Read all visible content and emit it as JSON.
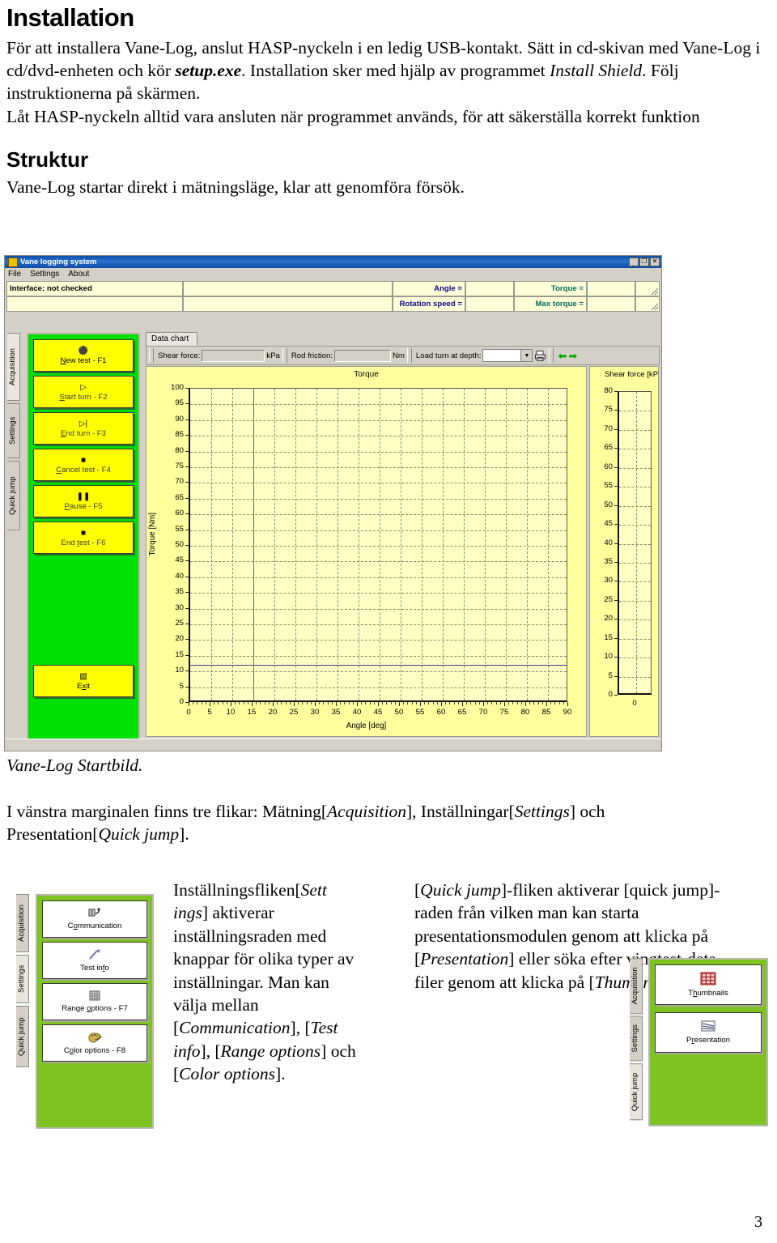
{
  "page": {
    "number": "3"
  },
  "sections": [
    {
      "heading": "Installation",
      "paragraph_runs": [
        {
          "t": "För att installera Vane-Log, anslut HASP-nyckeln i en ledig USB-kontakt. Sätt in cd-skivan med Vane-Log i cd/dvd-enheten och kör ",
          "s": "n"
        },
        {
          "t": "setup.exe",
          "s": "bi"
        },
        {
          "t": ". Installation sker med hjälp av programmet ",
          "s": "n"
        },
        {
          "t": "Install Shield",
          "s": "i"
        },
        {
          "t": ". Följ instruktionerna på skärmen.",
          "s": "n"
        },
        {
          "t": "BR",
          "s": "br"
        },
        {
          "t": "Låt HASP-nyckeln alltid vara ansluten när programmet används, för att säkerställa korrekt funktion",
          "s": "n"
        }
      ]
    },
    {
      "heading": "Struktur",
      "paragraph_runs": [
        {
          "t": "Vane-Log startar direkt i mätningsläge, klar att genomföra försök.",
          "s": "n"
        }
      ]
    }
  ],
  "caption": "Vane-Log Startbild.",
  "tabs_sentence_runs": [
    {
      "t": "I vänstra marginalen finns tre flikar: Mätning[",
      "s": "n"
    },
    {
      "t": "Acquisition",
      "s": "i"
    },
    {
      "t": "], Inställningar[",
      "s": "n"
    },
    {
      "t": "Settings",
      "s": "i"
    },
    {
      "t": "] och Presentation[",
      "s": "n"
    },
    {
      "t": "Quick jump",
      "s": "i"
    },
    {
      "t": "].",
      "s": "n"
    }
  ],
  "col_left_runs": [
    {
      "t": "Inställningsfliken[",
      "s": "n"
    },
    {
      "t": "Sett ings",
      "s": "i"
    },
    {
      "t": "] aktiverar inställningsraden med knappar för olika typer av inställningar. Man kan välja mellan [",
      "s": "n"
    },
    {
      "t": "Communication",
      "s": "i"
    },
    {
      "t": "], [",
      "s": "n"
    },
    {
      "t": "Test info",
      "s": "i"
    },
    {
      "t": "], [",
      "s": "n"
    },
    {
      "t": "Range options",
      "s": "i"
    },
    {
      "t": "] och [",
      "s": "n"
    },
    {
      "t": "Color options",
      "s": "i"
    },
    {
      "t": "].",
      "s": "n"
    }
  ],
  "col_right_runs": [
    {
      "t": "[",
      "s": "n"
    },
    {
      "t": "Quick jump",
      "s": "i"
    },
    {
      "t": "]-fliken aktiverar [quick jump]-raden från vilken man kan starta presentationsmodulen genom att klicka på [",
      "s": "n"
    },
    {
      "t": "Presentation",
      "s": "i"
    },
    {
      "t": "] eller söka efter vingtest-data filer genom att klicka på [",
      "s": "n"
    },
    {
      "t": "Thumbnails",
      "s": "i"
    },
    {
      "t": "].",
      "s": "n"
    }
  ],
  "main_window": {
    "title": "Vane logging system",
    "title_icon": "vane-app-icon",
    "window_buttons": [
      {
        "name": "minimize-button",
        "glyph": "_"
      },
      {
        "name": "maximize-button",
        "glyph": "❐"
      },
      {
        "name": "close-button",
        "glyph": "✕"
      }
    ],
    "menu": [
      "File",
      "Settings",
      "About"
    ],
    "readouts": {
      "interface_status": "Interface: not checked",
      "angle_label": "Angle =",
      "angle_value": "",
      "torque_label": "Torque =",
      "torque_value": "",
      "rotation_label": "Rotation speed =",
      "rotation_value": "",
      "max_torque_label": "Max torque =",
      "max_torque_value": ""
    },
    "side_tabs": [
      {
        "label": "Acquisition",
        "selected": true
      },
      {
        "label": "Settings",
        "selected": false
      },
      {
        "label": "Quick jump",
        "selected": false
      }
    ],
    "acquisition_buttons": [
      {
        "name": "new-test-button",
        "icon": "probe-icon",
        "glyph": "⬛",
        "pre": "",
        "accel": "N",
        "post": "ew test - F1",
        "dim": false
      },
      {
        "name": "start-turn-button",
        "icon": "play-icon",
        "glyph": "▶",
        "pre": "",
        "accel": "S",
        "post": "tart turn - F2",
        "dim": true
      },
      {
        "name": "end-turn-button",
        "icon": "play-to-end-icon",
        "glyph": "▶",
        "pre": "",
        "accel": "E",
        "post": "nd turn - F3",
        "dim": true
      },
      {
        "name": "cancel-test-button",
        "icon": "stop-icon",
        "glyph": "■",
        "pre": "",
        "accel": "C",
        "post": "ancel test - F4",
        "dim": true
      },
      {
        "name": "pause-button",
        "icon": "pause-icon",
        "glyph": "▐▌",
        "pre": "",
        "accel": "P",
        "post": "ause - F5",
        "dim": true
      },
      {
        "name": "end-test-button",
        "icon": "stop-icon",
        "glyph": "■",
        "pre": "End ",
        "accel": "t",
        "post": "est - F6",
        "dim": true
      },
      {
        "name": "exit-button",
        "icon": "door-exit-icon",
        "glyph": "▌",
        "pre": "E",
        "accel": "x",
        "post": "it",
        "dim": false
      }
    ],
    "inner_tab": "Data chart",
    "toolbar": {
      "shear_force_label": "Shear force:",
      "shear_force_value": "",
      "shear_force_unit": "kPa",
      "rod_friction_label": "Rod friction:",
      "rod_friction_value": "",
      "rod_friction_unit": "Nm",
      "load_turn_label": "Load turn at depth:",
      "load_turn_value": "",
      "print_icon": "printer-icon",
      "prev_icon": "arrow-left-icon",
      "next_icon": "arrow-right-icon"
    }
  },
  "chart_data": [
    {
      "type": "line",
      "name": "torque-vs-angle",
      "title": "Torque",
      "xlabel": "Angle [deg]",
      "ylabel": "Torque [Nm]",
      "xlim": [
        0,
        90
      ],
      "ylim": [
        0,
        100
      ],
      "xticks": [
        0,
        5,
        10,
        15,
        20,
        25,
        30,
        35,
        40,
        45,
        50,
        55,
        60,
        65,
        70,
        75,
        80,
        85,
        90
      ],
      "yticks": [
        0,
        5,
        10,
        15,
        20,
        25,
        30,
        35,
        40,
        45,
        50,
        55,
        60,
        65,
        70,
        75,
        80,
        85,
        90,
        95,
        100
      ],
      "grid": true,
      "legend": "none",
      "series": [
        {
          "name": "torque-limit-line",
          "color": "#3b3b8c",
          "type": "hline",
          "y": 12
        }
      ],
      "annotations": [
        {
          "name": "angle-marker",
          "type": "vline",
          "x": 15
        }
      ]
    },
    {
      "type": "bar",
      "name": "shear-force-gauge",
      "title": "Shear force [kPa]",
      "xlabel": "",
      "ylabel": "",
      "ylim": [
        0,
        80
      ],
      "yticks": [
        0,
        5,
        10,
        15,
        20,
        25,
        30,
        35,
        40,
        45,
        50,
        55,
        60,
        65,
        70,
        75,
        80
      ],
      "categories": [
        "0"
      ],
      "values": [
        0
      ],
      "grid": true,
      "legend": "none"
    }
  ],
  "settings_window": {
    "side_tabs": [
      {
        "label": "Acquisition",
        "selected": false
      },
      {
        "label": "Settings",
        "selected": true
      },
      {
        "label": "Quick jump",
        "selected": false
      }
    ],
    "buttons": [
      {
        "name": "communication-button",
        "icon": "plug-icon",
        "glyph": "✇",
        "pre": "C",
        "accel": "o",
        "post": "mmunication"
      },
      {
        "name": "test-info-button",
        "icon": "pencil-icon",
        "glyph": "✐",
        "pre": "Test in",
        "accel": "f",
        "post": "o"
      },
      {
        "name": "range-options-button",
        "icon": "grid-icon",
        "glyph": "▒",
        "pre": "Range ",
        "accel": "o",
        "post": "ptions - F7"
      },
      {
        "name": "color-options-button",
        "icon": "palette-icon",
        "glyph": "🎨",
        "pre": "C",
        "accel": "o",
        "post": "lor options - F8"
      }
    ]
  },
  "quickjump_window": {
    "side_tabs": [
      {
        "label": "Acquisition",
        "selected": false
      },
      {
        "label": "Settings",
        "selected": false
      },
      {
        "label": "Quick jump",
        "selected": true
      }
    ],
    "buttons": [
      {
        "name": "thumbnails-button",
        "icon": "thumbnail-grid-icon",
        "glyph": "▒",
        "pre": "T",
        "accel": "h",
        "post": "umbnails"
      },
      {
        "name": "presentation-button",
        "icon": "chart-icon",
        "glyph": "≣",
        "pre": "P",
        "accel": "r",
        "post": "esentation"
      }
    ]
  }
}
